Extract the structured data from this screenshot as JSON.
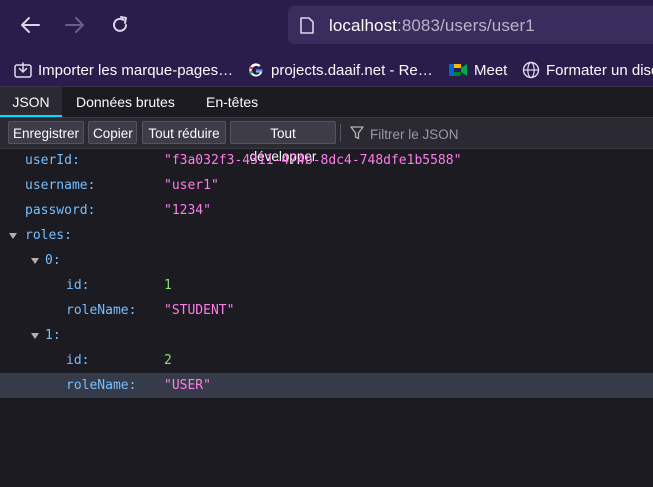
{
  "browser": {
    "url_host": "localhost",
    "url_rest": ":8083/users/user1",
    "bookmarks": [
      {
        "label": "Importer les marque-pages…",
        "icon": "import-icon"
      },
      {
        "label": "projects.daaif.net - Re…",
        "icon": "google-icon"
      },
      {
        "label": "Meet",
        "icon": "meet-icon"
      },
      {
        "label": "Formater un disq",
        "icon": "globe-icon"
      }
    ]
  },
  "viewer": {
    "tabs": [
      "JSON",
      "Données brutes",
      "En-têtes"
    ],
    "active_tab": "JSON",
    "toolbar": {
      "save": "Enregistrer",
      "copy": "Copier",
      "collapse_all": "Tout réduire",
      "expand_all": "Tout développer",
      "filter_placeholder": "Filtrer le JSON"
    }
  },
  "json": {
    "userId_key": "userId:",
    "userId_val": "\"f3a032f3-4311-474b-8dc4-748dfe1b5588\"",
    "username_key": "username:",
    "username_val": "\"user1\"",
    "password_key": "password:",
    "password_val": "\"1234\"",
    "roles_key": "roles:",
    "roles": [
      {
        "index_key": "0:",
        "id_key": "id:",
        "id_val": "1",
        "roleName_key": "roleName:",
        "roleName_val": "\"STUDENT\""
      },
      {
        "index_key": "1:",
        "id_key": "id:",
        "id_val": "2",
        "roleName_key": "roleName:",
        "roleName_val": "\"USER\""
      }
    ]
  },
  "colors": {
    "key": "#75bfff",
    "string": "#ff7de9",
    "number": "#86de74",
    "accent": "#00ddff"
  }
}
